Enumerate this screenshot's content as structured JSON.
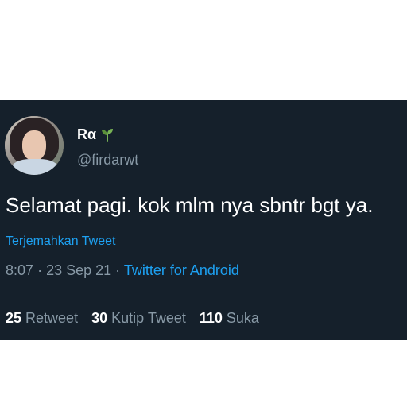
{
  "tweet": {
    "display_name": "Rα",
    "emoji_icon": "seedling-icon",
    "handle": "@firdarwt",
    "text": "Selamat pagi. kok mlm nya sbntr bgt ya.",
    "translate_label": "Terjemahkan Tweet",
    "time": "8:07",
    "date": "23 Sep 21",
    "separator": "·",
    "source": "Twitter for Android"
  },
  "stats": [
    {
      "count": "25",
      "label": "Retweet"
    },
    {
      "count": "30",
      "label": "Kutip Tweet"
    },
    {
      "count": "110",
      "label": "Suka"
    }
  ],
  "colors": {
    "background": "#15202b",
    "text": "#ffffff",
    "secondary": "#8899a6",
    "accent": "#1da1f2",
    "divider": "#38444d"
  }
}
